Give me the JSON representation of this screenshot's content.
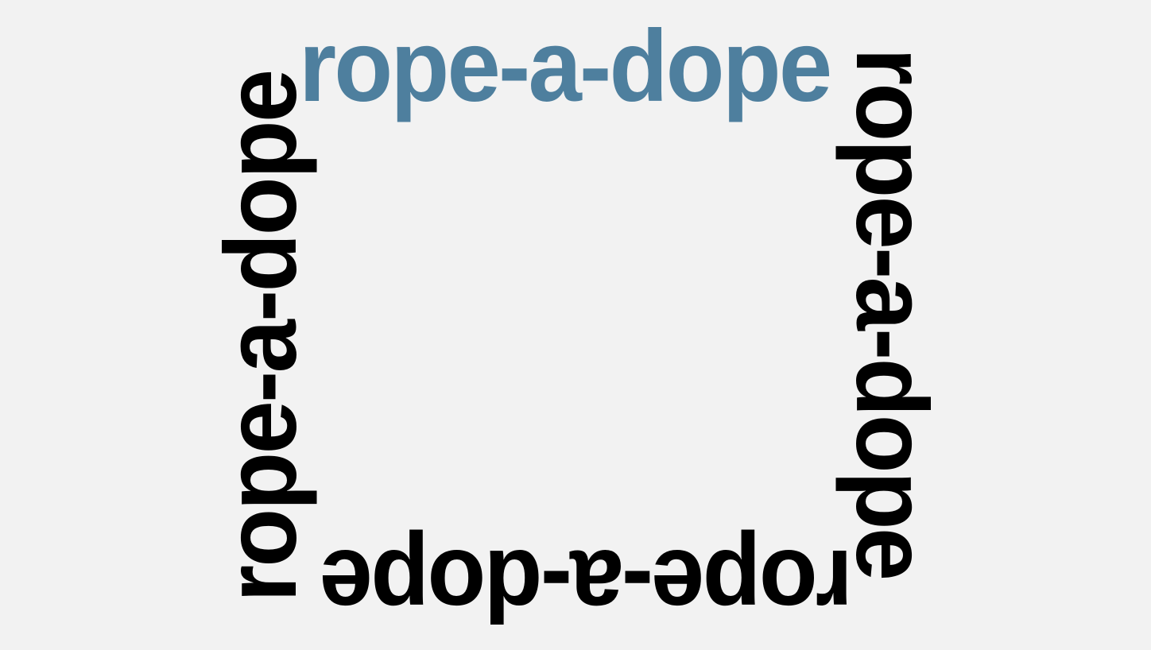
{
  "phrase": {
    "top": "rope-a-dope",
    "right": "rope-a-dope",
    "bottom": "rope-a-dope",
    "left": "rope-a-dope"
  },
  "colors": {
    "background": "#f2f2f2",
    "accent": "#4e7f9e",
    "text": "#000000"
  }
}
